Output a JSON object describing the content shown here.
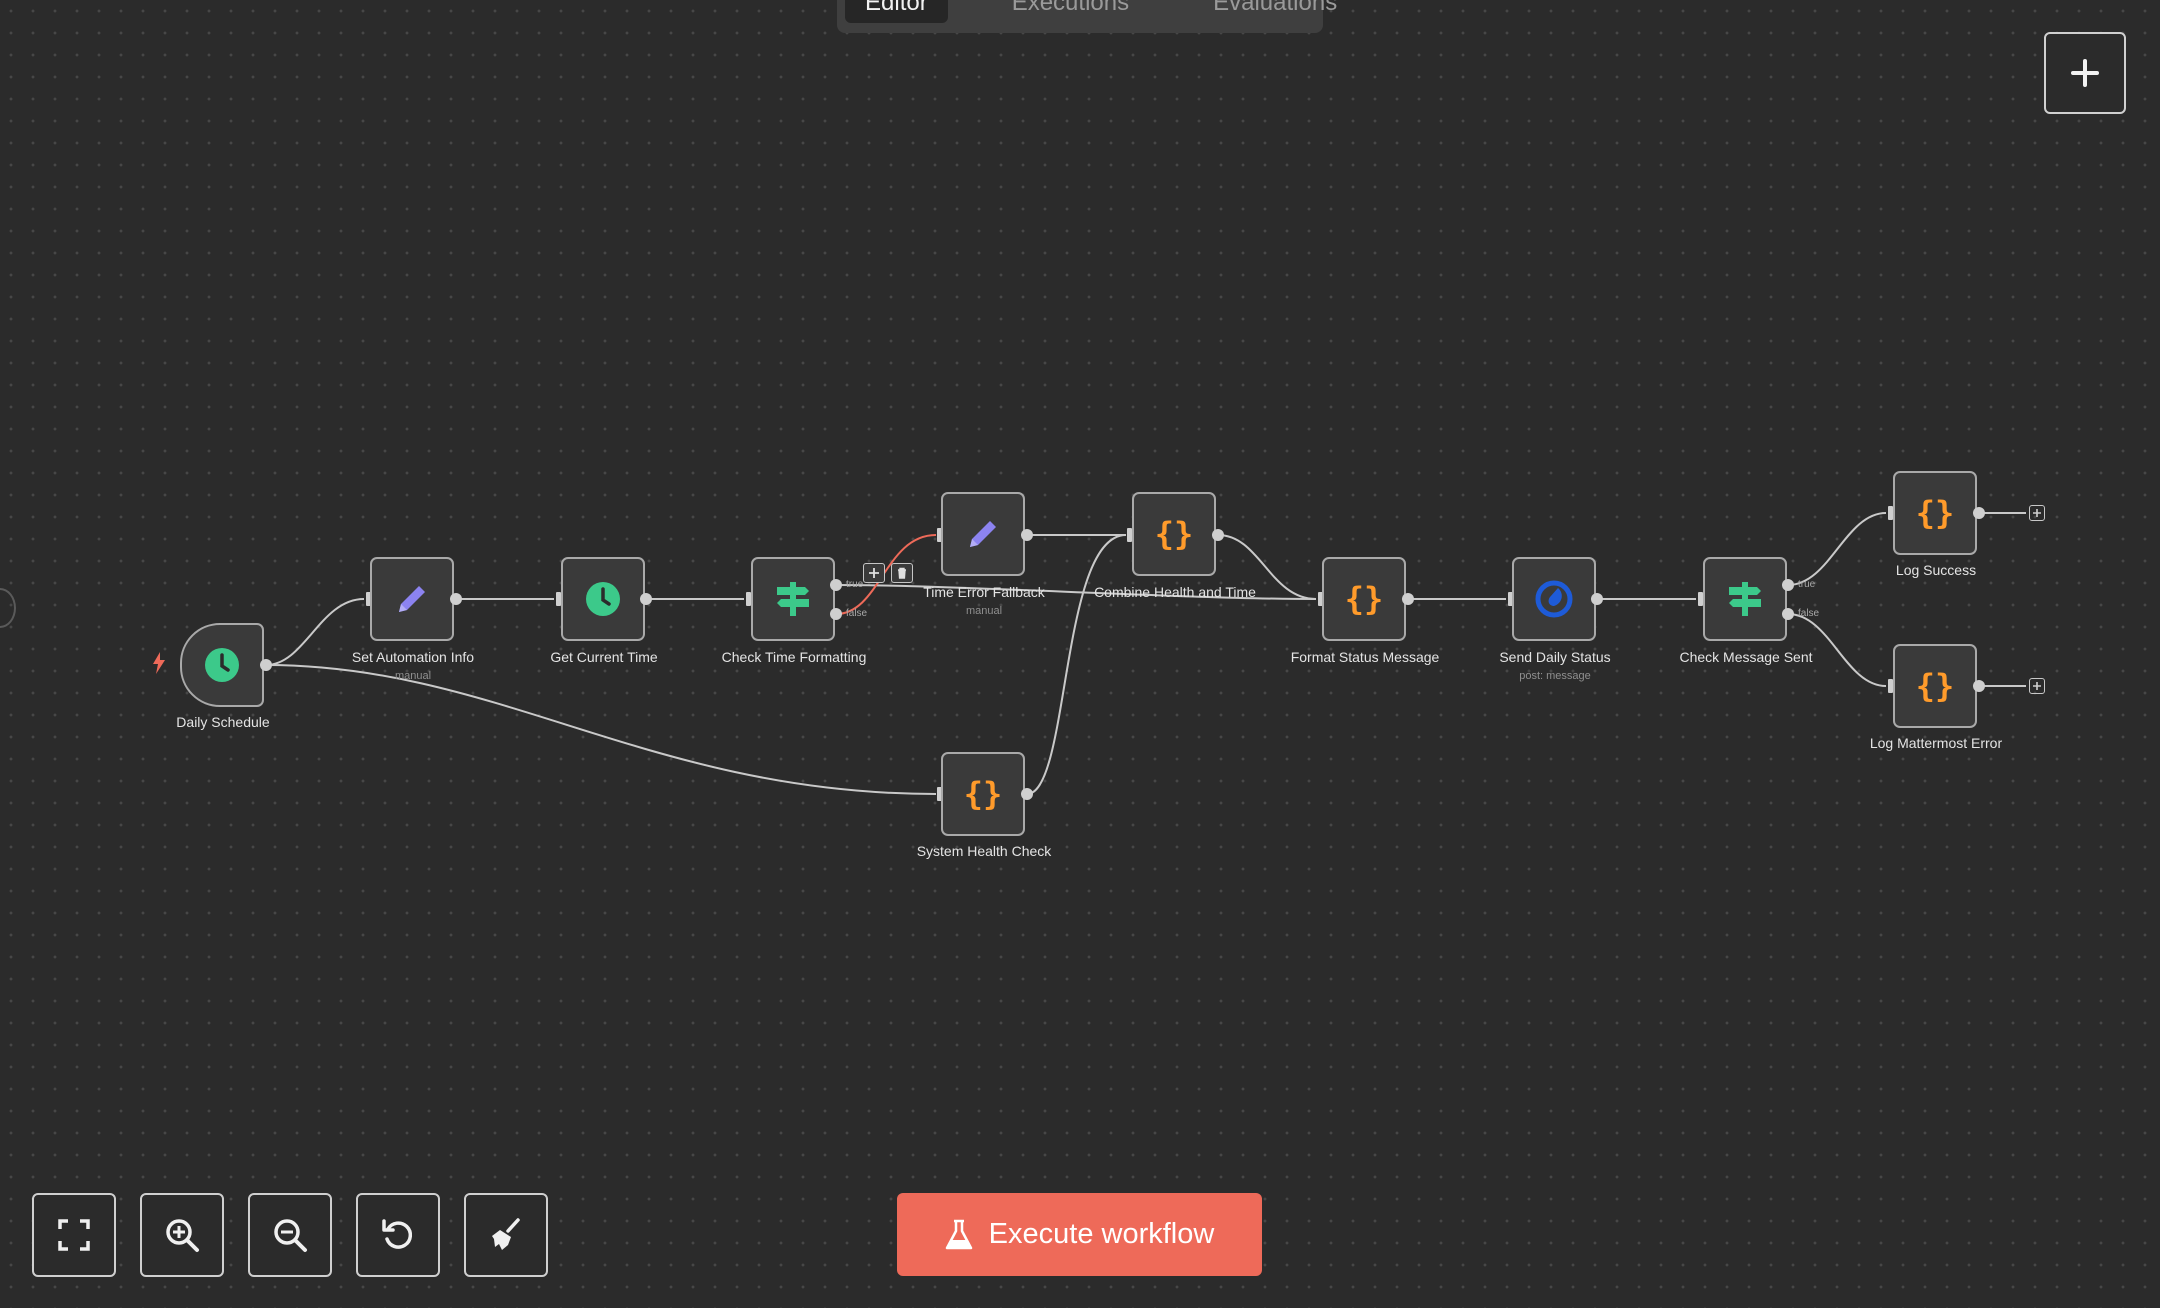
{
  "tabs": [
    {
      "label": "Editor",
      "active": true
    },
    {
      "label": "Executions",
      "active": false
    },
    {
      "label": "Evaluations",
      "active": false
    }
  ],
  "nodes": {
    "daily_schedule": {
      "label": "Daily Schedule",
      "icon": "clock-icon"
    },
    "set_automation_info": {
      "label": "Set Automation Info",
      "sub": "manual",
      "icon": "pencil-icon"
    },
    "get_current_time": {
      "label": "Get Current Time",
      "icon": "clock-icon"
    },
    "check_time_formatting": {
      "label": "Check Time Formatting",
      "icon": "if-signpost-icon",
      "outputs": [
        "true",
        "false"
      ]
    },
    "time_error_fallback": {
      "label": "Time Error Fallback",
      "sub": "manual",
      "icon": "pencil-icon"
    },
    "combine_health_and_time": {
      "label": "Combine Health and Time",
      "icon": "code-braces-icon"
    },
    "format_status_message": {
      "label": "Format Status Message",
      "icon": "code-braces-icon"
    },
    "send_daily_status": {
      "label": "Send Daily Status",
      "sub": "post: message",
      "icon": "mattermost-icon"
    },
    "check_message_sent": {
      "label": "Check Message Sent",
      "icon": "if-signpost-icon",
      "outputs": [
        "true",
        "false"
      ]
    },
    "log_success": {
      "label": "Log Success",
      "icon": "code-braces-icon"
    },
    "log_mattermost_error": {
      "label": "Log Mattermost Error",
      "icon": "code-braces-icon"
    },
    "system_health_check": {
      "label": "System Health Check",
      "icon": "code-braces-icon"
    }
  },
  "controls": {
    "fit_view": "expand-icon",
    "zoom_in": "zoom-in-icon",
    "zoom_out": "zoom-out-icon",
    "reset_zoom": "undo-icon",
    "tidy_up": "broom-icon"
  },
  "execute_button": {
    "label": "Execute workflow",
    "icon": "flask-icon"
  },
  "colors": {
    "canvas": "#2b2b2b",
    "accent": "#ee6a59",
    "green": "#3cc98a",
    "purple": "#8c83f0",
    "orange": "#ff9b2b",
    "mattermost": "#1e5bd8"
  }
}
